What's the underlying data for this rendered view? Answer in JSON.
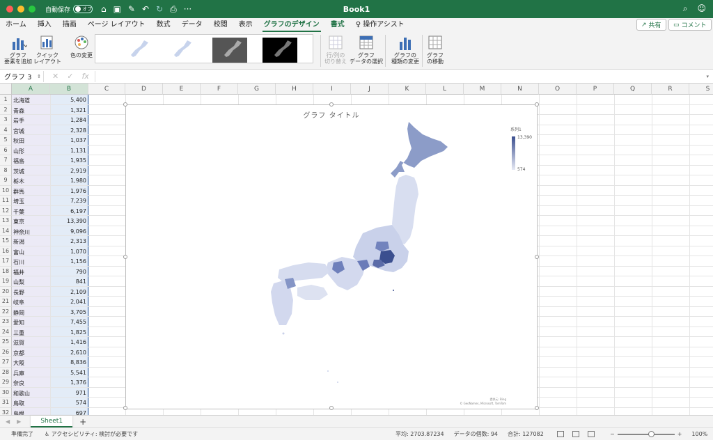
{
  "window": {
    "title": "Book1",
    "autosave_label": "自動保存",
    "autosave_state": "オフ"
  },
  "tabs": [
    "ホーム",
    "挿入",
    "描画",
    "ページ レイアウト",
    "数式",
    "データ",
    "校閲",
    "表示",
    "グラフのデザイン",
    "書式",
    "操作アシスト"
  ],
  "tab_active": "グラフのデザイン",
  "share_label": "共有",
  "comment_label": "コメント",
  "ribbon": {
    "add_element": "グラフ\n要素を追加",
    "quick_layout": "クイック\nレイアウト",
    "change_colors": "色の変更",
    "switch_rowcol": "行/列の\n切り替え",
    "select_data": "グラフ\nデータの選択",
    "change_type": "グラフの\n種類の変更",
    "move_chart": "グラフ\nの移動"
  },
  "formula": {
    "name_box": "グラフ 3",
    "fx": "fx"
  },
  "columns": [
    "A",
    "B",
    "C",
    "D",
    "E",
    "F",
    "G",
    "H",
    "I",
    "J",
    "K",
    "L",
    "M",
    "N",
    "O",
    "P",
    "Q",
    "R",
    "S"
  ],
  "rows": [
    {
      "n": "1",
      "a": "北海道",
      "b": "5,400"
    },
    {
      "n": "2",
      "a": "青森",
      "b": "1,321"
    },
    {
      "n": "3",
      "a": "岩手",
      "b": "1,284"
    },
    {
      "n": "4",
      "a": "宮城",
      "b": "2,328"
    },
    {
      "n": "5",
      "a": "秋田",
      "b": "1,037"
    },
    {
      "n": "6",
      "a": "山形",
      "b": "1,131"
    },
    {
      "n": "7",
      "a": "福島",
      "b": "1,935"
    },
    {
      "n": "8",
      "a": "茨城",
      "b": "2,919"
    },
    {
      "n": "9",
      "a": "栃木",
      "b": "1,980"
    },
    {
      "n": "10",
      "a": "群馬",
      "b": "1,976"
    },
    {
      "n": "11",
      "a": "埼玉",
      "b": "7,239"
    },
    {
      "n": "12",
      "a": "千葉",
      "b": "6,197"
    },
    {
      "n": "13",
      "a": "東京",
      "b": "13,390"
    },
    {
      "n": "14",
      "a": "神奈川",
      "b": "9,096"
    },
    {
      "n": "15",
      "a": "新潟",
      "b": "2,313"
    },
    {
      "n": "16",
      "a": "富山",
      "b": "1,070"
    },
    {
      "n": "17",
      "a": "石川",
      "b": "1,156"
    },
    {
      "n": "18",
      "a": "福井",
      "b": "790"
    },
    {
      "n": "19",
      "a": "山梨",
      "b": "841"
    },
    {
      "n": "20",
      "a": "長野",
      "b": "2,109"
    },
    {
      "n": "21",
      "a": "岐阜",
      "b": "2,041"
    },
    {
      "n": "22",
      "a": "静岡",
      "b": "3,705"
    },
    {
      "n": "23",
      "a": "愛知",
      "b": "7,455"
    },
    {
      "n": "24",
      "a": "三重",
      "b": "1,825"
    },
    {
      "n": "25",
      "a": "滋賀",
      "b": "1,416"
    },
    {
      "n": "26",
      "a": "京都",
      "b": "2,610"
    },
    {
      "n": "27",
      "a": "大阪",
      "b": "8,836"
    },
    {
      "n": "28",
      "a": "兵庫",
      "b": "5,541"
    },
    {
      "n": "29",
      "a": "奈良",
      "b": "1,376"
    },
    {
      "n": "30",
      "a": "和歌山",
      "b": "971"
    },
    {
      "n": "31",
      "a": "鳥取",
      "b": "574"
    },
    {
      "n": "32",
      "a": "島根",
      "b": "697"
    }
  ],
  "chart": {
    "title": "グラフ タイトル",
    "legend_title": "系列1",
    "legend_max": "13,390",
    "legend_min": "574",
    "credit_1": "提供元: Bing",
    "credit_2": "© GeoNames, Microsoft, TomTom",
    "colors": {
      "high": "#3b4f8f",
      "low": "#e6e9f4"
    }
  },
  "sheet": {
    "tab": "Sheet1",
    "add": "+"
  },
  "status": {
    "ready": "準備完了",
    "accessibility": "アクセシビリティ: 検討が必要です",
    "average": "平均: 2703.87234",
    "count": "データの個数: 94",
    "sum": "合計: 127082",
    "zoom": "100%"
  }
}
